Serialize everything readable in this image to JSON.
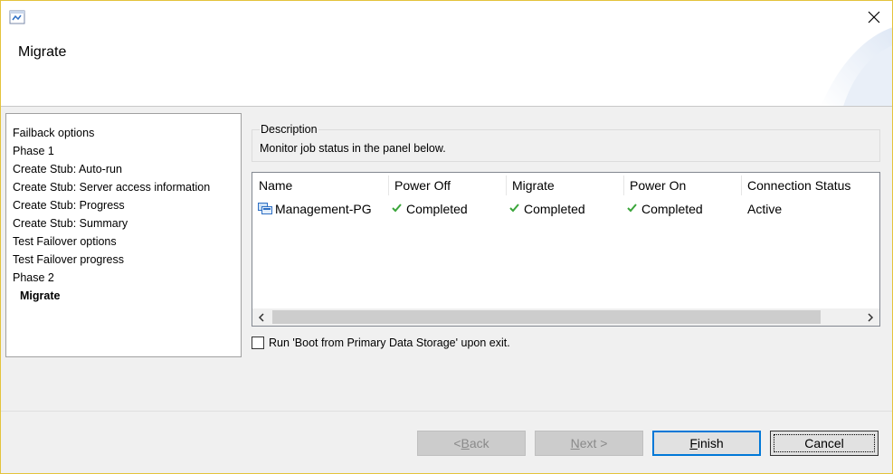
{
  "window": {
    "title": "Migrate",
    "close_icon": "close-icon",
    "app_icon": "wizard-app-icon"
  },
  "steps": {
    "items": [
      {
        "label": "Failback options",
        "active": false
      },
      {
        "label": "Phase 1",
        "active": false
      },
      {
        "label": "Create Stub: Auto-run",
        "active": false
      },
      {
        "label": "Create Stub: Server access information",
        "active": false
      },
      {
        "label": "Create Stub: Progress",
        "active": false
      },
      {
        "label": "Create Stub: Summary",
        "active": false
      },
      {
        "label": "Test Failover  options",
        "active": false
      },
      {
        "label": "Test Failover  progress",
        "active": false
      },
      {
        "label": "Phase 2",
        "active": false
      },
      {
        "label": "Migrate",
        "active": true
      }
    ]
  },
  "description": {
    "legend": "Description",
    "text": "Monitor job status in the panel below."
  },
  "table": {
    "columns": [
      "Name",
      "Power Off",
      "Migrate",
      "Power On",
      "Connection Status"
    ],
    "rows": [
      {
        "name": "Management-PG",
        "power_off": "Completed",
        "migrate": "Completed",
        "power_on": "Completed",
        "connection_status": "Active"
      }
    ]
  },
  "options": {
    "boot_checkbox_label": "Run 'Boot from Primary Data Storage' upon exit.",
    "boot_checked": false
  },
  "buttons": {
    "back": {
      "prefix": "< ",
      "mnemonic": "B",
      "rest": "ack"
    },
    "next": {
      "mnemonic": "N",
      "rest": "ext >"
    },
    "finish": {
      "mnemonic": "F",
      "rest": "inish"
    },
    "cancel": "Cancel"
  },
  "colors": {
    "check_green": "#3aa53a",
    "accent_blue": "#0078d7",
    "window_border": "#e4c33c"
  }
}
